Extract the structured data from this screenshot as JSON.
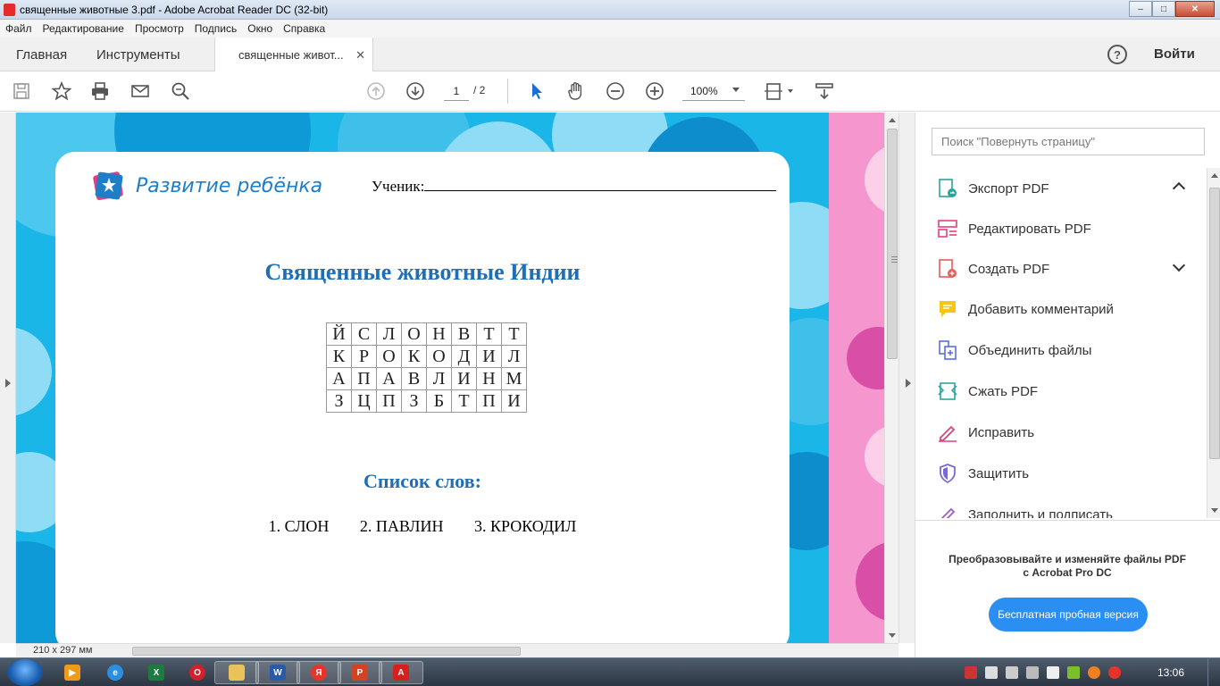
{
  "window": {
    "title": "священные животные 3.pdf - Adobe Acrobat Reader DC (32-bit)",
    "controls": {
      "minimize": "–",
      "maximize": "□",
      "close": "✕"
    }
  },
  "menu": [
    "Файл",
    "Редактирование",
    "Просмотр",
    "Подпись",
    "Окно",
    "Справка"
  ],
  "tabs": {
    "home": "Главная",
    "tools": "Инструменты",
    "document": "священные живот...",
    "close_glyph": "✕",
    "help_glyph": "?",
    "signin": "Войти"
  },
  "toolbar": {
    "icons": [
      "save-icon",
      "star-icon",
      "print-icon",
      "email-icon",
      "search-zoom-icon",
      "page-up-icon",
      "page-down-icon",
      "select-arrow-icon",
      "hand-icon",
      "zoom-out-icon",
      "zoom-in-icon",
      "fit-page-icon",
      "read-mode-icon"
    ],
    "page_current": "1",
    "page_total": "/ 2",
    "zoom": "100%"
  },
  "document": {
    "logo_text": "Развитие ребёнка",
    "student_label": "Ученик:",
    "title": "Священные животные Индии",
    "grid": [
      [
        "Й",
        "С",
        "Л",
        "О",
        "Н",
        "В",
        "Т",
        "Т"
      ],
      [
        "К",
        "Р",
        "О",
        "К",
        "О",
        "Д",
        "И",
        "Л"
      ],
      [
        "А",
        "П",
        "А",
        "В",
        "Л",
        "И",
        "Н",
        "М"
      ],
      [
        "З",
        "Ц",
        "П",
        "З",
        "Б",
        "Т",
        "П",
        "И"
      ]
    ],
    "words_title": "Список слов:",
    "words": [
      "1. СЛОН",
      "2. ПАВЛИН",
      "3. КРОКОДИЛ"
    ],
    "page_size": "210 x 297 мм",
    "colors": {
      "background_blue": "#1ab6e8",
      "title_blue": "#1e6fb5",
      "pink": "#f596cf"
    }
  },
  "right_panel": {
    "search_placeholder": "Поиск \"Повернуть страницу\"",
    "tools": [
      {
        "label": "Экспорт PDF",
        "icon": "export-pdf-icon",
        "color": "#26a69a",
        "expanded": true
      },
      {
        "label": "Редактировать PDF",
        "icon": "edit-pdf-icon",
        "color": "#e0407f"
      },
      {
        "label": "Создать PDF",
        "icon": "create-pdf-icon",
        "color": "#e85c5c",
        "collapsed": true
      },
      {
        "label": "Добавить комментарий",
        "icon": "comment-icon",
        "color": "#f5c518"
      },
      {
        "label": "Объединить файлы",
        "icon": "combine-files-icon",
        "color": "#5b6ee1"
      },
      {
        "label": "Сжать PDF",
        "icon": "compress-pdf-icon",
        "color": "#2aa7a0"
      },
      {
        "label": "Исправить",
        "icon": "fix-pen-icon",
        "color": "#e0407f"
      },
      {
        "label": "Защитить",
        "icon": "shield-icon",
        "color": "#7a68d8"
      },
      {
        "label": "Заполнить и подписать",
        "icon": "fill-sign-icon",
        "color": "#9b5cd1"
      }
    ],
    "promo_text_line1": "Преобразовывайте и изменяйте файлы PDF",
    "promo_text_line2": "с Acrobat Pro DC",
    "promo_button": "Бесплатная пробная версия"
  },
  "taskbar": {
    "apps": [
      "media-player-icon",
      "ie-icon",
      "excel-icon",
      "opera-icon",
      "explorer-icon",
      "word-icon",
      "yandex-icon",
      "powerpoint-icon",
      "acrobat-icon"
    ],
    "clock": "13:06"
  }
}
